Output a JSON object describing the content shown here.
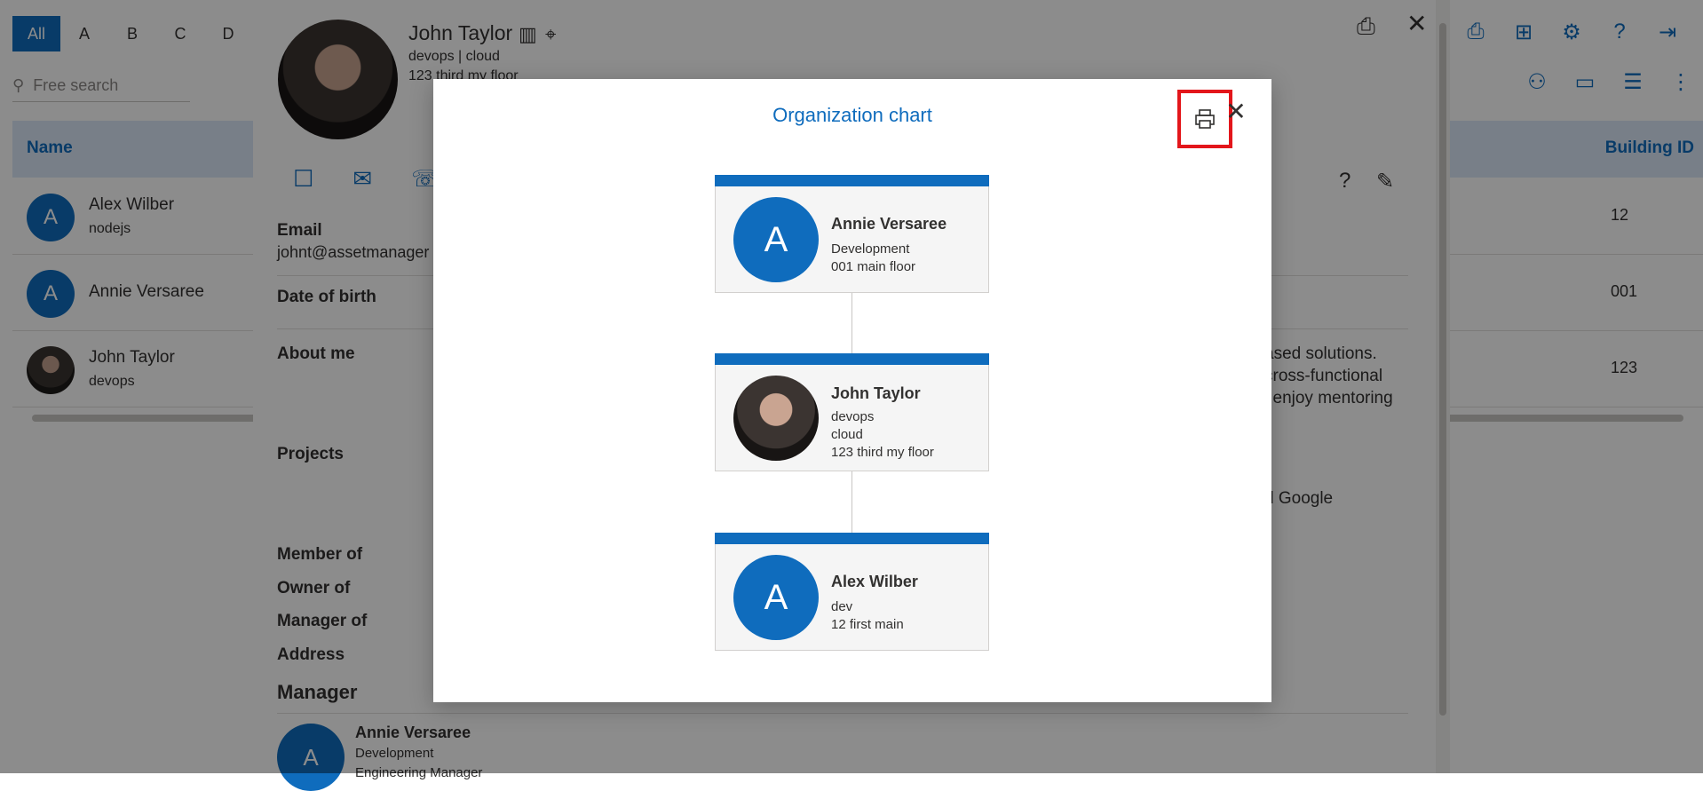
{
  "letters": [
    "All",
    "A",
    "B",
    "C",
    "D"
  ],
  "search": {
    "placeholder": "Free search"
  },
  "table": {
    "name_header": "Name",
    "building_header": "Building ID",
    "rows": [
      {
        "name": "Alex Wilber",
        "sub": "nodejs",
        "building": "12",
        "avatar": "A"
      },
      {
        "name": "Annie Versaree",
        "sub": "",
        "building": "001",
        "avatar": "A"
      },
      {
        "name": "John Taylor",
        "sub": "devops",
        "building": "123",
        "avatar": ""
      }
    ]
  },
  "profile": {
    "name": "John Taylor",
    "line1": "devops | cloud",
    "line2": "123 third my floor",
    "email_label": "Email",
    "email_value": "johnt@assetmanager",
    "dob_label": "Date of birth",
    "about_label": "About me",
    "about_text": [
      "ased solutions.",
      "cross-functional",
      "l enjoy mentoring"
    ],
    "projects_label": "Projects",
    "projects_text": "d Google",
    "member_label": "Member of",
    "owner_label": "Owner of",
    "manager_of_label": "Manager of",
    "address_label": "Address",
    "manager_heading": "Manager",
    "manager": {
      "name": "Annie Versaree",
      "dept": "Development",
      "role": "Engineering Manager",
      "avatar": "A"
    }
  },
  "dialog": {
    "title": "Organization chart",
    "cards": [
      {
        "name": "Annie Versaree",
        "lines": [
          "Development",
          "001 main floor"
        ],
        "avatar": "A"
      },
      {
        "name": "John Taylor",
        "lines": [
          "devops",
          "cloud",
          "123 third my floor"
        ],
        "avatar": ""
      },
      {
        "name": "Alex Wilber",
        "lines": [
          "dev",
          "12 first main"
        ],
        "avatar": "A"
      }
    ]
  },
  "colors": {
    "accent": "#0f6cbd",
    "highlight": "#e3161b"
  }
}
